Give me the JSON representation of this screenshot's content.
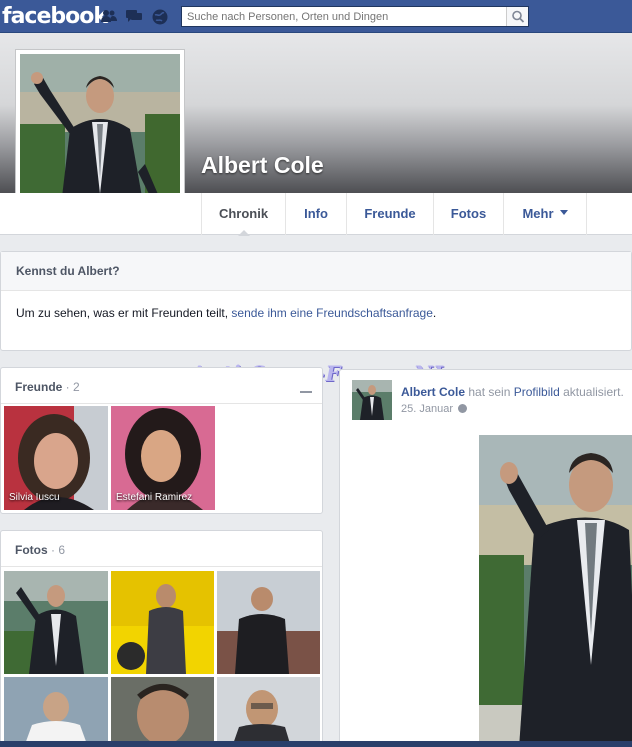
{
  "topbar": {
    "logo": "facebook",
    "search_placeholder": "Suche nach Personen, Orten und Dingen",
    "jewels": [
      "friend-requests-icon",
      "messages-icon",
      "notifications-icon"
    ]
  },
  "profile": {
    "name": "Albert Cole"
  },
  "tabs": [
    {
      "label": "Chronik",
      "active": true
    },
    {
      "label": "Info"
    },
    {
      "label": "Freunde"
    },
    {
      "label": "Fotos"
    },
    {
      "label": "Mehr"
    }
  ],
  "know_box": {
    "title": "Kennst du Albert?",
    "text_prefix": "Um zu sehen, was er mit Freunden teilt, ",
    "link": "sende ihm eine Freundschaftsanfrage",
    "text_suffix": "."
  },
  "watermark": "Anti-Scam-Forum-NL",
  "friends": {
    "title": "Freunde",
    "count": " · 2",
    "items": [
      {
        "name": "Silvia Iuscu"
      },
      {
        "name": "Estefani Ramirez"
      }
    ]
  },
  "photos": {
    "title": "Fotos",
    "count": " · 6"
  },
  "post": {
    "author": "Albert Cole",
    "action_prefix": " hat sein ",
    "action_link": "Profilbild",
    "action_suffix": " aktualisiert.",
    "date": "25. Januar"
  },
  "colors": {
    "brand_blue": "#3b5998",
    "page_bg": "#e9ebee",
    "link": "#3b5998"
  }
}
